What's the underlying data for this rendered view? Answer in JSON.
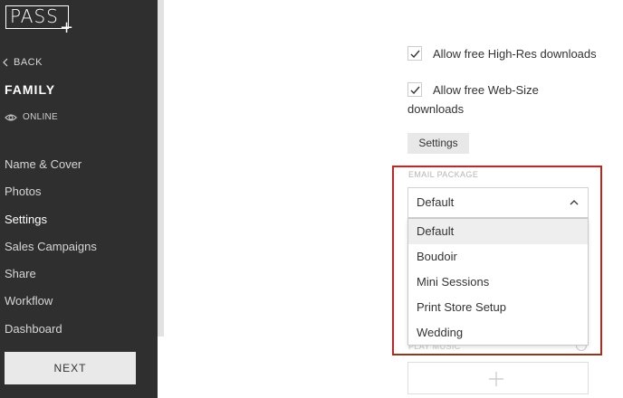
{
  "sidebar": {
    "logo_text": "PASS",
    "logo_plus": "+",
    "back_label": "BACK",
    "gallery_title": "FAMILY",
    "status_label": "ONLINE",
    "nav_items": [
      {
        "label": "Name & Cover"
      },
      {
        "label": "Photos"
      },
      {
        "label": "Settings"
      },
      {
        "label": "Sales Campaigns"
      },
      {
        "label": "Share"
      },
      {
        "label": "Workflow"
      },
      {
        "label": "Dashboard"
      }
    ],
    "active_item": "Settings",
    "next_label": "NEXT"
  },
  "main": {
    "checkbox_highres": {
      "label": "Allow free High-Res downloads",
      "checked": true
    },
    "checkbox_websize": {
      "label_line1": "Allow free Web-Size",
      "label_line2": "downloads",
      "checked": true
    },
    "settings_button": "Settings",
    "email_package": {
      "label": "EMAIL PACKAGE",
      "selected": "Default",
      "options": [
        "Default",
        "Boudoir",
        "Mini Sessions",
        "Print Store Setup",
        "Wedding"
      ]
    },
    "play_music_label": "PLAY MUSIC"
  },
  "colors": {
    "sidebar_bg": "#2f2f2f",
    "highlight_border": "#cc2222"
  }
}
